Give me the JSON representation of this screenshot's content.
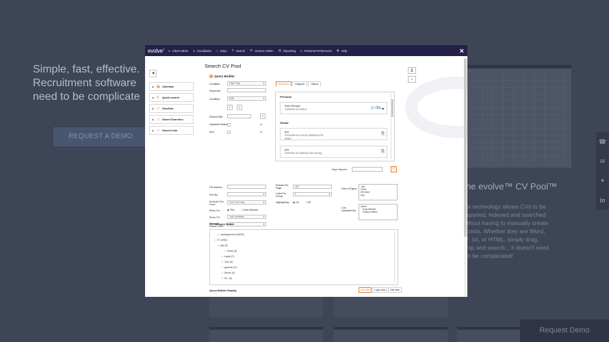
{
  "background": {
    "hero_lines": [
      "Simple, fast, effective.",
      "Recruitment software",
      "need to be complicate"
    ],
    "demo_button": "REQUEST A DEMO",
    "pool_title": "he evolve™ CV Pool™",
    "pool_text_lines": [
      "ur technology allows CVs to be",
      "sported, indexed and searched",
      "ithout having to manually create",
      "cords. Whether they are Word,",
      "F, txt, or HTML, simply drag,",
      "rop and search... it doesn't need",
      "to be complicated!"
    ],
    "request_demo": "Request Demo",
    "social_icons": [
      "phone-icon",
      "mail-icon",
      "twitter-icon",
      "linkedin-icon"
    ]
  },
  "modal": {
    "logo": "evolve",
    "logo_mark": "®",
    "nav": [
      {
        "label": "Client Admin",
        "icon": "user-icon"
      },
      {
        "label": "Candidates",
        "icon": "users-icon"
      },
      {
        "label": "Diary",
        "icon": "calendar-icon"
      },
      {
        "label": "Search",
        "icon": "search-icon"
      },
      {
        "label": "Generic Admin",
        "icon": "wrench-icon"
      },
      {
        "label": "Reporting",
        "icon": "chart-icon"
      },
      {
        "label": "Personal Preferences",
        "icon": "tag-icon"
      },
      {
        "label": "Help",
        "icon": "help-icon"
      }
    ],
    "close": "×",
    "page_title": "Search CV Pool",
    "side_menu": [
      {
        "label": "Calendar"
      },
      {
        "label": "Quick search"
      },
      {
        "label": "Shortlist"
      },
      {
        "label": "Saved Searches"
      },
      {
        "label": "Saved Lists"
      }
    ],
    "query_builder": {
      "title": "Query Builder",
      "condition_label": "Condition:",
      "condition_value": "Filter Point",
      "keywords_label": "Keywords:",
      "condition2_label": "Condition:",
      "condition2_value": "AND",
      "extend_with_label": "Extend With:",
      "uploaded_between_label": "Uploaded Between:",
      "and_label": "And:"
    },
    "tabs": [
      "Searches",
      "Snippets",
      "History"
    ],
    "saved_panel": {
      "personal_header": "Personal",
      "global_header": "Global",
      "personal_rows": [
        {
          "title": "Sales Manager",
          "date": "12/09/2011 at 15:55:41",
          "extra": ""
        }
      ],
      "global_rows": [
        {
          "title": "java",
          "date": "07/03/2009 at 12:21:09 (CDEMO0) POF",
          "extra": "DEMO"
        },
        {
          "title": "java",
          "date": "22/09/2011 at 15:55:55 (Chris Fenney)",
          "extra": ""
        }
      ]
    },
    "save_search_label": "Save Search:",
    "options": {
      "file_names_label": "File Names:",
      "sort_by_label": "Sort By:",
      "exclude_cvs_label": "Exclude CVs From:",
      "exclude_cvs_value": "Your CVs Lists...",
      "show_on_label": "Show On:",
      "show_on_options": [
        "This",
        "New Window"
      ],
      "show_cv_label": "Show CV:",
      "show_cv_value": "Just candidate",
      "keyword_limit_label": "Keyword Search Limit:",
      "keyword_limit_value": "50",
      "results_per_page_label": "Results Per Page:",
      "results_per_page_value": "100",
      "links_per_group_label": "Links Per Group:",
      "links_per_group_value": "5",
      "highlighting_label": "Highlighting:",
      "highlighting_options": [
        "On",
        "Off"
      ],
      "file_types_label": "Files of Types:",
      "file_types": [
        ".doc",
        "HTML",
        "MS Word",
        "PDF"
      ],
      "uploaded_by_label": "CVs Uploaded By:",
      "uploaded_by": [
        "Active",
        "Andy Mitchell",
        "Anthony Weber"
      ]
    },
    "cv_category_search": "CV Category Search",
    "tree_items": [
      "uncategorized (00000)",
      "IT (1952)",
      "php (0)",
      "Clean (0)",
      "mysql (7)",
      "Cars (0)",
      "general (11)",
      "Sexter (0)",
      "Sh...(3)"
    ],
    "query_builder_display": "Query Builder Display",
    "view_buttons": [
      "Info view",
      "Logic view",
      "Edit view"
    ]
  }
}
